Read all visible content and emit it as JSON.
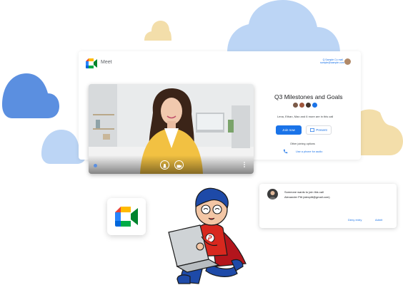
{
  "colors": {
    "brand_blue": "#1a73e8",
    "cloud_blue_dark": "#5b8fe0",
    "cloud_blue_light": "#bcd5f5",
    "cloud_yellow": "#f3deaa",
    "meet_green": "#00ac47",
    "meet_yellow": "#ffba00",
    "meet_red": "#ea4335",
    "meet_blue": "#2684fc"
  },
  "header": {
    "app_name": "Meet",
    "account_line1": "Q Sample Co mail",
    "account_line2": "sample@sample.com"
  },
  "meeting": {
    "title": "Q3 Milestones and Goals",
    "participants_text": "Lena, Ethan, Max and 6 more are in this call",
    "join_label": "Join now",
    "present_label": "Present",
    "other_options_label": "Other joining options",
    "phone_label": "Use a phone for audio",
    "icons": [
      "mic-icon",
      "camera-icon",
      "more-vert-icon",
      "phone-icon",
      "present-icon"
    ]
  },
  "notification": {
    "message": "Someone wants to join this call",
    "requester": "Alexander Pitt (alexpitt@gmail.com)",
    "deny_label": "Deny entry",
    "admit_label": "Admit"
  }
}
